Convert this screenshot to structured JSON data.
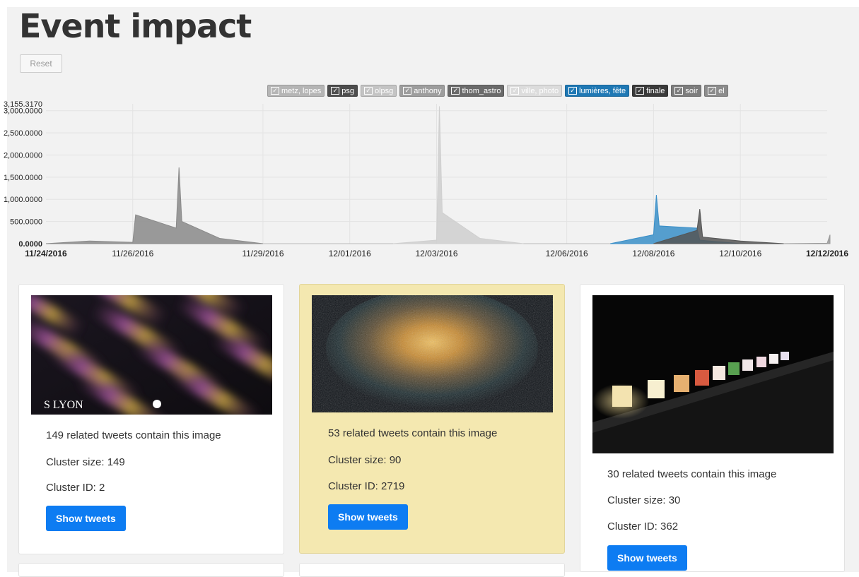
{
  "page": {
    "title": "Event impact",
    "reset_label": "Reset"
  },
  "legend": [
    {
      "label": "metz, lopes",
      "color": "#b5b5b5"
    },
    {
      "label": "psg",
      "color": "#4d4d4d"
    },
    {
      "label": "olpsg",
      "color": "#c4c4c4"
    },
    {
      "label": "anthony",
      "color": "#9d9d9d"
    },
    {
      "label": "thom_astro",
      "color": "#6a6a6a"
    },
    {
      "label": "ville, photo",
      "color": "#dcdcdc"
    },
    {
      "label": "lumières, fête",
      "color": "#1f78b4"
    },
    {
      "label": "finale",
      "color": "#3a3a3a"
    },
    {
      "label": "soir",
      "color": "#7d7d7d"
    },
    {
      "label": "el",
      "color": "#8c8c8c"
    }
  ],
  "chart_data": {
    "type": "area",
    "ylim": [
      0,
      3155.317
    ],
    "y_ticks": [
      "0.0000",
      "500.0000",
      "1,000.0000",
      "1,500.0000",
      "2,000.0000",
      "2,500.0000",
      "3,000.0000"
    ],
    "y_max_label": "3,155.3170",
    "x_ticks": [
      "11/24/2016",
      "11/26/2016",
      "11/29/2016",
      "12/01/2016",
      "12/03/2016",
      "12/06/2016",
      "12/08/2016",
      "12/10/2016",
      "12/12/2016"
    ],
    "series": [
      {
        "name": "psg",
        "color": "#8a8a8a",
        "x": [
          "11/24/2016",
          "11/25/2016",
          "11/26/2016",
          "11/26/2016",
          "11/27/2016",
          "11/27/2016",
          "11/27/2016",
          "11/28/2016",
          "11/29/2016"
        ],
        "values": [
          0,
          60,
          30,
          650,
          350,
          1720,
          500,
          120,
          0
        ]
      },
      {
        "name": "ville, photo",
        "color": "#cfcfcf",
        "x": [
          "12/02/2016",
          "12/03/2016",
          "12/03/2016",
          "12/03/2016",
          "12/04/2016",
          "12/05/2016"
        ],
        "values": [
          0,
          80,
          3100,
          700,
          120,
          0
        ]
      },
      {
        "name": "lumières, fête",
        "color": "#3a8fc8",
        "x": [
          "12/07/2016",
          "12/08/2016",
          "12/08/2016",
          "12/08/2016",
          "12/09/2016",
          "12/09/2016",
          "12/10/2016"
        ],
        "values": [
          0,
          200,
          1100,
          400,
          350,
          80,
          0
        ]
      },
      {
        "name": "finale",
        "color": "#555555",
        "x": [
          "12/08/2016",
          "12/09/2016",
          "12/09/2016",
          "12/09/2016",
          "12/10/2016",
          "12/11/2016"
        ],
        "values": [
          0,
          300,
          780,
          150,
          60,
          0
        ]
      },
      {
        "name": "el",
        "color": "#9a9a9a",
        "x": [
          "12/11/2016",
          "12/12/2016",
          "12/12/2016"
        ],
        "values": [
          0,
          10,
          200
        ]
      }
    ]
  },
  "cards": [
    {
      "caption": "149 related tweets contain this image",
      "size": "Cluster size: 149",
      "id": "Cluster ID: 2",
      "button": "Show tweets",
      "logo_text": "S  LYON"
    },
    {
      "caption": "53 related tweets contain this image",
      "size": "Cluster size: 90",
      "id": "Cluster ID: 2719",
      "button": "Show tweets"
    },
    {
      "caption": "30 related tweets contain this image",
      "size": "Cluster size: 30",
      "id": "Cluster ID: 362",
      "button": "Show tweets"
    }
  ]
}
